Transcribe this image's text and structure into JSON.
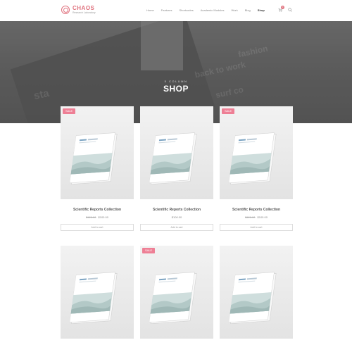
{
  "header": {
    "logo_name": "CHAOS",
    "logo_tagline": "Research Laboratory",
    "nav": [
      "Home",
      "Features",
      "Shortcodes",
      "Academic Modules",
      "Work",
      "Blog",
      "Shop"
    ],
    "active_nav": "Shop",
    "cart_count": "0"
  },
  "hero": {
    "subtitle": "5 COLUMN",
    "title": "SHOP",
    "bg_words": [
      "fashion",
      "back to work",
      "surf co",
      "sta"
    ]
  },
  "products": [
    {
      "title": "Scientific Reports Collection",
      "price": "$100.00",
      "old_price": "$120.00",
      "sale": true,
      "sale_label": "SALE",
      "button": "Add to cart"
    },
    {
      "title": "Scientific Reports Collection",
      "price": "$100.00",
      "old_price": "",
      "sale": false,
      "sale_label": "",
      "button": "Add to cart"
    },
    {
      "title": "Scientific Reports Collection",
      "price": "$100.00",
      "old_price": "$120.00",
      "sale": true,
      "sale_label": "SALE",
      "button": "Add to cart"
    },
    {
      "title": "",
      "price": "",
      "old_price": "",
      "sale": false,
      "sale_label": "",
      "button": ""
    },
    {
      "title": "",
      "price": "",
      "old_price": "",
      "sale": true,
      "sale_label": "SALE",
      "button": ""
    },
    {
      "title": "",
      "price": "",
      "old_price": "",
      "sale": false,
      "sale_label": "",
      "button": ""
    }
  ],
  "colors": {
    "accent": "#e0737f",
    "sale": "#ee7f95"
  },
  "icons": {
    "cart": "cart-icon",
    "search": "search-icon",
    "logo": "atom-icon"
  }
}
